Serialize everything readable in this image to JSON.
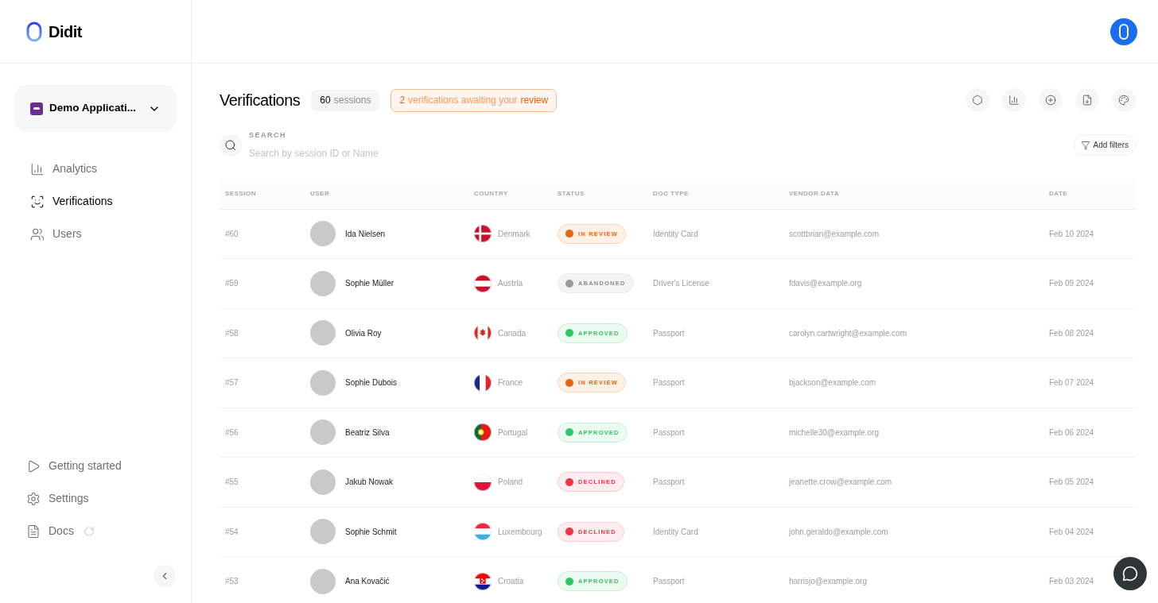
{
  "brand": {
    "name": "Didit"
  },
  "app_selector": {
    "label": "Demo Applicati..."
  },
  "nav": [
    {
      "label": "Analytics",
      "selected": false
    },
    {
      "label": "Verifications",
      "selected": true
    },
    {
      "label": "Users",
      "selected": false
    }
  ],
  "nav_bottom": [
    {
      "label": "Getting started"
    },
    {
      "label": "Settings"
    },
    {
      "label": "Docs"
    }
  ],
  "page": {
    "title": "Verifications",
    "count": "60",
    "count_label": "sessions",
    "review_count": "2",
    "review_text": "verifications awaiting your",
    "review_link": "review"
  },
  "search": {
    "label": "SEARCH",
    "placeholder": "Search by session ID or Name"
  },
  "filters_button": "Add filters",
  "table": {
    "columns": [
      "SESSION",
      "USER",
      "COUNTRY",
      "STATUS",
      "DOC TYPE",
      "VENDOR DATA",
      "DATE"
    ],
    "rows": [
      {
        "session": "#60",
        "user": "Ida Nielsen",
        "country": "Denmark",
        "status": "IN REVIEW",
        "kind": "review",
        "doc_type": "Identity Card",
        "vendor_data": "scottbrian@example.com",
        "date": "Feb 10 2024"
      },
      {
        "session": "#59",
        "user": "Sophie Müller",
        "country": "Austria",
        "status": "ABANDONED",
        "kind": "abandoned",
        "doc_type": "Driver's License",
        "vendor_data": "fdavis@example.org",
        "date": "Feb 09 2024"
      },
      {
        "session": "#58",
        "user": "Olivia Roy",
        "country": "Canada",
        "status": "APPROVED",
        "kind": "approved",
        "doc_type": "Passport",
        "vendor_data": "carolyn.cartwright@example.com",
        "date": "Feb 08 2024"
      },
      {
        "session": "#57",
        "user": "Sophie Dubois",
        "country": "France",
        "status": "IN REVIEW",
        "kind": "review",
        "doc_type": "Passport",
        "vendor_data": "bjackson@example.com",
        "date": "Feb 07 2024"
      },
      {
        "session": "#56",
        "user": "Beatriz Silva",
        "country": "Portugal",
        "status": "APPROVED",
        "kind": "approved",
        "doc_type": "Passport",
        "vendor_data": "michelle30@example.org",
        "date": "Feb 06 2024"
      },
      {
        "session": "#55",
        "user": "Jakub Nowak",
        "country": "Poland",
        "status": "DECLINED",
        "kind": "declined",
        "doc_type": "Passport",
        "vendor_data": "jeanette.crow@example.com",
        "date": "Feb 05 2024"
      },
      {
        "session": "#54",
        "user": "Sophie Schmit",
        "country": "Luxembourg",
        "status": "DECLINED",
        "kind": "declined",
        "doc_type": "Identity Card",
        "vendor_data": "john.geraldo@example.com",
        "date": "Feb 04 2024"
      },
      {
        "session": "#53",
        "user": "Ana Kovačić",
        "country": "Croatia",
        "status": "APPROVED",
        "kind": "approved",
        "doc_type": "Passport",
        "vendor_data": "harrisjo@example.org",
        "date": "Feb 03 2024"
      }
    ]
  }
}
